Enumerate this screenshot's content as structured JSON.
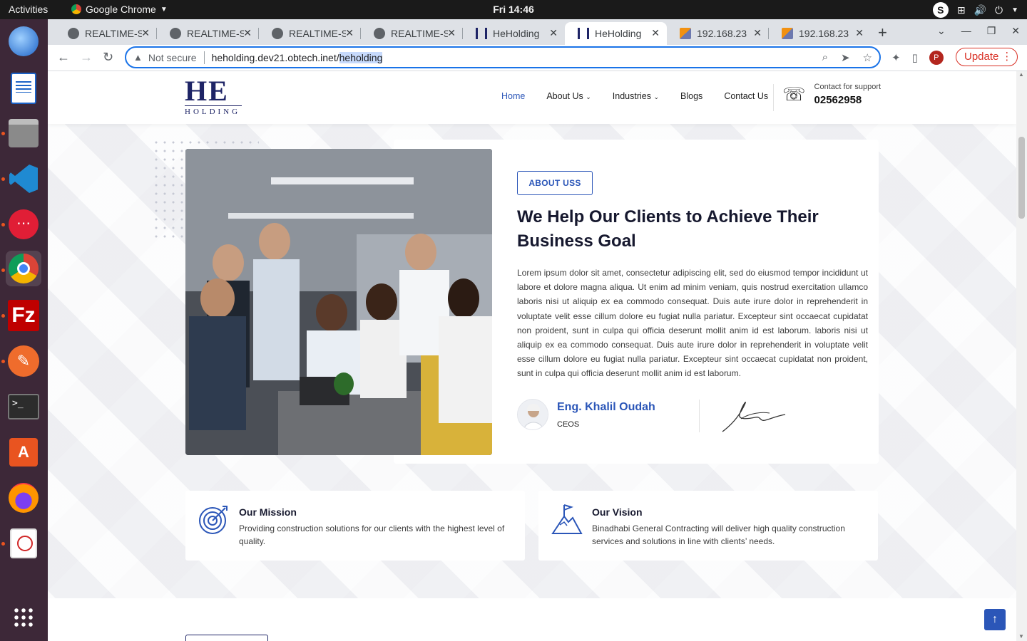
{
  "os": {
    "activities": "Activities",
    "app_name": "Google Chrome",
    "clock": "Fri 14:46"
  },
  "browser": {
    "tabs": [
      {
        "title": "REALTIME-S",
        "active": false
      },
      {
        "title": "REALTIME-S",
        "active": false
      },
      {
        "title": "REALTIME-S",
        "active": false
      },
      {
        "title": "REALTIME-S",
        "active": false
      },
      {
        "title": "HeHolding",
        "active": false
      },
      {
        "title": "HeHolding",
        "active": true
      },
      {
        "title": "192.168.23",
        "active": false
      },
      {
        "title": "192.168.23",
        "active": false
      }
    ],
    "security_label": "Not secure",
    "url_prefix": "heholding.dev21.obtech.inet/",
    "url_highlight": "heholding",
    "profile_initial": "P",
    "update_label": "Update"
  },
  "site": {
    "logo_main": "HE",
    "logo_sub": "HOLDING",
    "menu": {
      "home": "Home",
      "about": "About Us",
      "industries": "Industries",
      "blogs": "Blogs",
      "contact": "Contact Us"
    },
    "support_label": "Contact for support",
    "support_number": "02562958"
  },
  "about": {
    "badge": "ABOUT USS",
    "title": "We Help Our Clients to Achieve Their Business Goal",
    "body": "Lorem ipsum dolor sit amet, consectetur adipiscing elit, sed do eiusmod tempor incididunt ut labore et dolore magna aliqua. Ut enim ad minim veniam, quis nostrud exercitation ullamco laboris nisi ut aliquip ex ea commodo consequat. Duis aute irure dolor in reprehenderit in voluptate velit esse cillum dolore eu fugiat nulla pariatur. Excepteur sint occaecat cupidatat non proident, sunt in culpa qui officia deserunt mollit anim id est laborum. laboris nisi ut aliquip ex ea commodo consequat. Duis aute irure dolor in reprehenderit in voluptate velit esse cillum dolore eu fugiat nulla pariatur. Excepteur sint occaecat cupidatat non proident, sunt in culpa qui officia deserunt mollit anim id est laborum.",
    "author_name": "Eng. Khalil Oudah",
    "author_role": "CEOS"
  },
  "mission": {
    "title": "Our Mission",
    "text": "Providing construction solutions for our clients with the highest level of quality."
  },
  "vision": {
    "title": "Our Vision",
    "text": "Binadhabi General Contracting will deliver high quality construction services and solutions in line with clients’ needs."
  },
  "colors": {
    "brand_blue": "#2b56b8",
    "navy": "#1e2466",
    "dock": "#3d2838"
  }
}
